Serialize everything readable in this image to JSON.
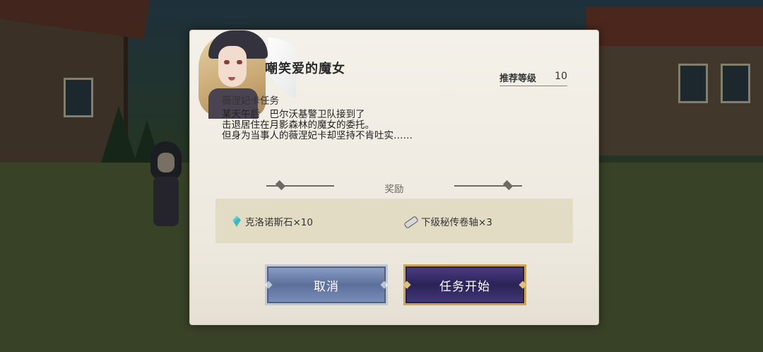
{
  "quest": {
    "title": "嘲笑爱的魔女",
    "level_label": "推荐等级",
    "level_value": "10",
    "subtitle": "薇涅妃卡任务",
    "description": [
      "某天午后　巴尔沃基警卫队接到了",
      "击退居住在月影森林的魔女的委托。",
      "但身为当事人的薇涅妃卡却坚持不肯吐实……"
    ]
  },
  "rewards": {
    "header": "奖励",
    "items": [
      {
        "icon": "crystal-icon",
        "label": "克洛诺斯石×10"
      },
      {
        "icon": "scroll-icon",
        "label": "下级秘传卷轴×3"
      }
    ]
  },
  "buttons": {
    "cancel": "取消",
    "start": "任务开始"
  },
  "colors": {
    "dialog_bg": "#f1ede4",
    "reward_box": "#e3dcc5",
    "cancel_button": "#7388b3",
    "start_button": "#3a2f6e",
    "start_border": "#c8a35a"
  }
}
